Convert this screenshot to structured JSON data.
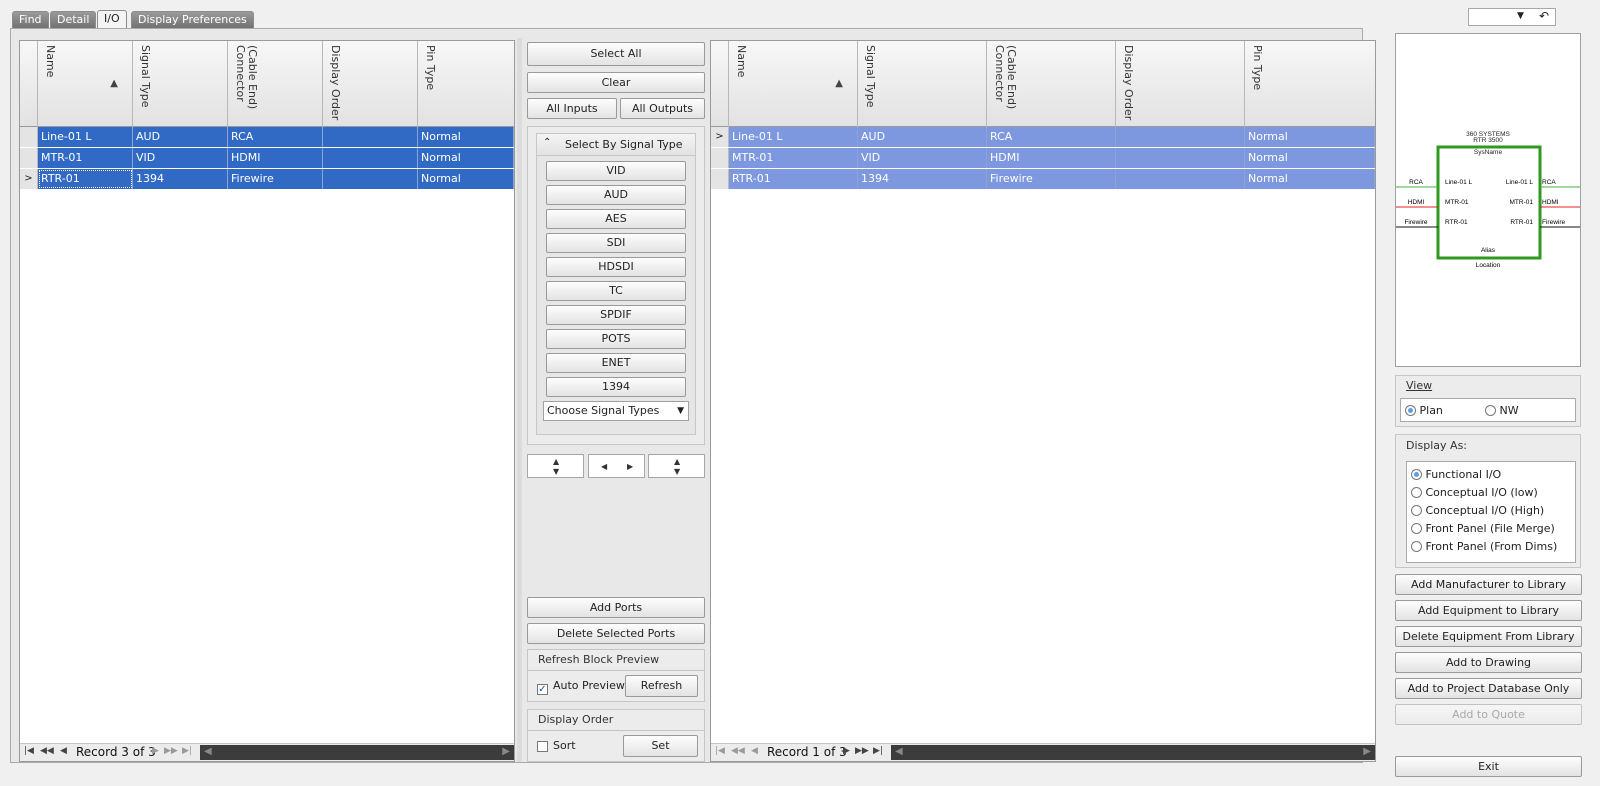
{
  "tabs": [
    {
      "label": "Find"
    },
    {
      "label": "Detail"
    },
    {
      "label": "I/O",
      "active": true
    },
    {
      "label": "Display Preferences"
    }
  ],
  "top_right": {
    "dropdown_icon": "▼",
    "undo_icon": "↶"
  },
  "inputs_grid": {
    "columns": [
      "Name",
      "Signal Type",
      "(Cable End)\nConnector",
      "Display Order",
      "Pin Type"
    ],
    "rows": [
      {
        "name": "Line-01 L",
        "signal_type": "AUD",
        "connector": "RCA",
        "display_order": "",
        "pin_type": "Normal"
      },
      {
        "name": "MTR-01",
        "signal_type": "VID",
        "connector": "HDMI",
        "display_order": "",
        "pin_type": "Normal"
      },
      {
        "name": "RTR-01",
        "signal_type": "1394",
        "connector": "Firewire",
        "display_order": "",
        "pin_type": "Normal"
      }
    ],
    "record_text": "Record 3 of 3"
  },
  "outputs_grid": {
    "columns": [
      "Name",
      "Signal Type",
      "(Cable End)\nConnector",
      "Display Order",
      "Pin Type"
    ],
    "rows": [
      {
        "name": "Line-01 L",
        "signal_type": "AUD",
        "connector": "RCA",
        "display_order": "",
        "pin_type": "Normal"
      },
      {
        "name": "MTR-01",
        "signal_type": "VID",
        "connector": "HDMI",
        "display_order": "",
        "pin_type": "Normal"
      },
      {
        "name": "RTR-01",
        "signal_type": "1394",
        "connector": "Firewire",
        "display_order": "",
        "pin_type": "Normal"
      }
    ],
    "record_text": "Record 1 of 3"
  },
  "middle": {
    "select_all": "Select All",
    "clear": "Clear",
    "all_inputs": "All Inputs",
    "all_outputs": "All Outputs",
    "select_by_signal_type": "Select By Signal Type",
    "signal_types": [
      "VID",
      "AUD",
      "AES",
      "SDI",
      "HDSDI",
      "TC",
      "SPDIF",
      "POTS",
      "ENET",
      "1394"
    ],
    "choose_signal_types": "Choose Signal Types",
    "add_ports": "Add Ports",
    "delete_selected_ports": "Delete Selected Ports",
    "refresh_block_preview": "Refresh Block Preview",
    "auto_preview": "Auto Preview",
    "auto_preview_checked": true,
    "refresh": "Refresh",
    "display_order": "Display Order",
    "sort": "Sort",
    "sort_checked": false,
    "set": "Set"
  },
  "preview": {
    "manufacturer": "360 SYSTEMS",
    "model": "RTR 3500",
    "sysname": "SysName",
    "alias": "Alias",
    "location": "Location",
    "left_connectors": [
      "RCA",
      "HDMI",
      "Firewire"
    ],
    "left_ports": [
      "Line-01 L",
      "MTR-01",
      "RTR-01"
    ],
    "right_ports": [
      "Line-01 L",
      "MTR-01",
      "RTR-01"
    ],
    "right_connectors": [
      "RCA",
      "HDMI",
      "Firewire"
    ],
    "wire_colors": [
      "#3cb043",
      "#e02020",
      "#111111"
    ],
    "box_color": "#2e9a1e"
  },
  "view": {
    "title": "View",
    "options": [
      {
        "label": "Plan",
        "selected": true
      },
      {
        "label": "NW",
        "selected": false
      }
    ]
  },
  "display_as": {
    "title": "Display As:",
    "options": [
      {
        "label": "Functional I/O",
        "selected": true
      },
      {
        "label": "Conceptual I/O (low)",
        "selected": false
      },
      {
        "label": "Conceptual I/O (High)",
        "selected": false
      },
      {
        "label": "Front Panel (File Merge)",
        "selected": false
      },
      {
        "label": "Front Panel (From Dims)",
        "selected": false
      }
    ]
  },
  "actions": {
    "add_manufacturer": "Add Manufacturer to Library",
    "add_equipment": "Add Equipment to Library",
    "delete_equipment": "Delete Equipment From Library",
    "add_to_drawing": "Add to Drawing",
    "add_to_project_db": "Add to Project Database Only",
    "add_to_quote": "Add to Quote",
    "exit": "Exit"
  }
}
